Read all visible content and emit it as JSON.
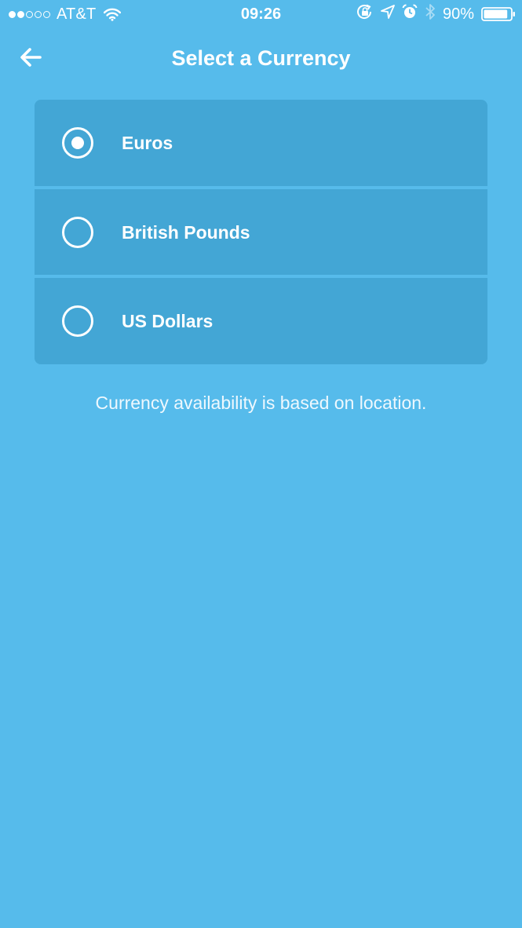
{
  "status_bar": {
    "signal_bars_filled": 2,
    "signal_bars_total": 5,
    "carrier": "AT&T",
    "time": "09:26",
    "battery_percent": "90%",
    "battery_level": 0.9,
    "icons": [
      "wifi-icon",
      "orientation-lock-icon",
      "location-arrow-icon",
      "alarm-icon",
      "bluetooth-icon",
      "battery-icon"
    ]
  },
  "header": {
    "back_icon": "arrow-left-icon",
    "title": "Select a Currency"
  },
  "currencies": [
    {
      "label": "Euros",
      "selected": true
    },
    {
      "label": "British Pounds",
      "selected": false
    },
    {
      "label": "US Dollars",
      "selected": false
    }
  ],
  "footnote": "Currency availability is based on location.",
  "colors": {
    "background": "#56bbeb",
    "option_background": "#43a6d5",
    "text": "#ffffff"
  }
}
